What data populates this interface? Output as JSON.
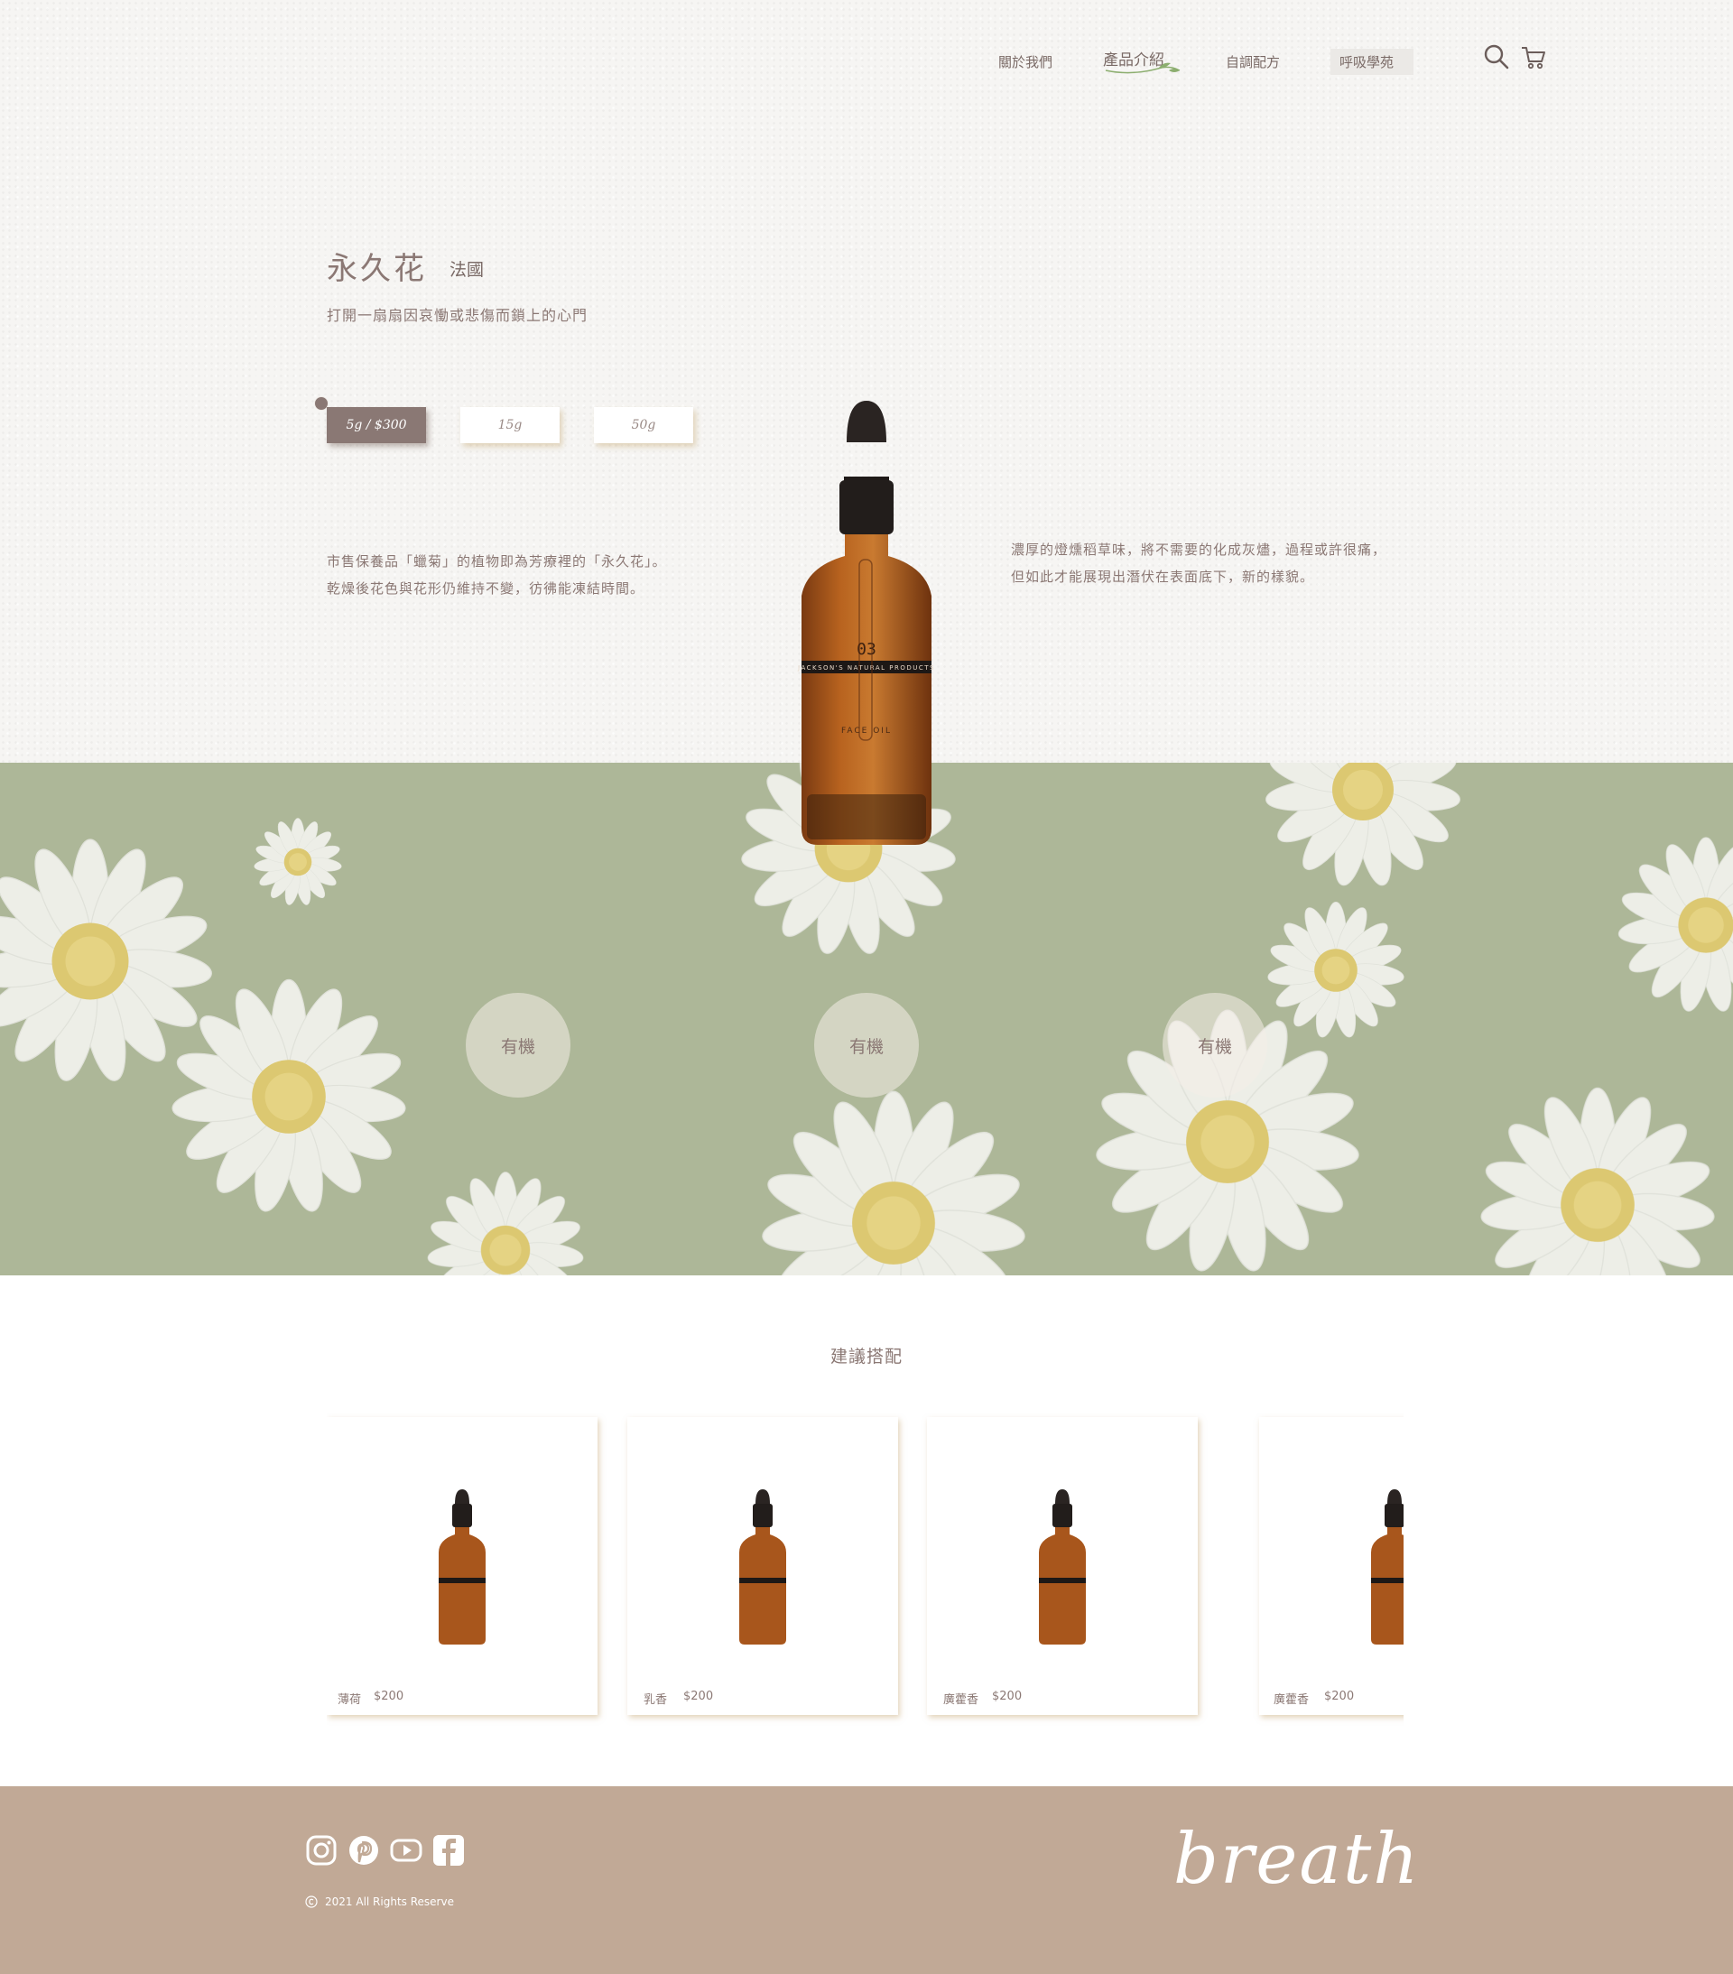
{
  "nav": {
    "items": [
      {
        "label": "關於我們"
      },
      {
        "label": "產品介紹"
      },
      {
        "label": "自調配方"
      },
      {
        "label": "呼吸學苑"
      }
    ],
    "search_icon": "search-icon",
    "cart_icon": "cart-icon"
  },
  "product": {
    "name": "永久花",
    "origin": "法國",
    "subtitle": "打開一扇扇因哀慟或悲傷而鎖上的心門",
    "sizes": [
      {
        "label": "5g / $300",
        "selected": true
      },
      {
        "label": "15g",
        "selected": false
      },
      {
        "label": "50g",
        "selected": false
      }
    ],
    "desc_left": [
      "市售保養品「蠟菊」的植物即為芳療裡的「永久花」。",
      "乾燥後花色與花形仍維持不變，彷彿能凍結時間。"
    ],
    "desc_right": [
      "濃厚的燈燻稻草味，將不需要的化成灰燼，過程或許很痛，",
      "但如此才能展現出潛伏在表面底下，新的樣貌。"
    ],
    "bottle_label_number": "03",
    "bottle_label_band": "JACKSON'S NATURAL PRODUCTS",
    "bottle_label_type": "FACE OIL"
  },
  "features": [
    {
      "label": "有機"
    },
    {
      "label": "有機"
    },
    {
      "label": "有機"
    }
  ],
  "suggestions": {
    "title": "建議搭配",
    "items": [
      {
        "name": "薄荷",
        "price": "$200"
      },
      {
        "name": "乳香",
        "price": "$200"
      },
      {
        "name": "廣藿香",
        "price": "$200"
      },
      {
        "name": "廣藿香",
        "price": "$200"
      }
    ]
  },
  "footer": {
    "social": [
      "instagram-icon",
      "pinterest-icon",
      "youtube-icon",
      "facebook-icon"
    ],
    "copyright": "2021 All Rights Reserve",
    "brand": "breath"
  },
  "colors": {
    "accent": "#8a7874",
    "footer_bg": "#c1a996",
    "paper_bg": "#f6f5f3",
    "bottle_amber": "#a0501c"
  }
}
